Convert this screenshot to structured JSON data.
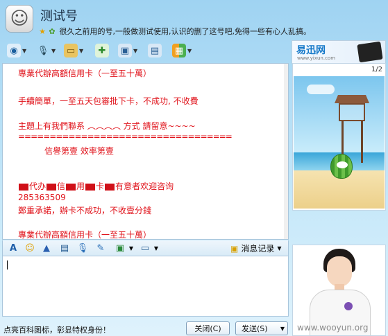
{
  "header": {
    "title": "测试号",
    "signature": "很久之前用的号,一般做测试使用,认识的删了这号吧,免得一些有心人乱搞。"
  },
  "ad": {
    "logo": "易迅网",
    "url": "www.yixun.com"
  },
  "messages": [
    "專業代辦高額信用卡（一至五十萬）",
    "手續簡單，一至五天包審批下卡，不成功, 不收費",
    "主題上有我們聯系 ︵︵︵︵  方式       請留意~~~~",
    "==================================",
    "信譽第壹          效率第壹",
    "代办",
    "信",
    "用",
    "卡",
    "有意者欢迎咨询",
    "285363509",
    "鄭重承諾，辦卡不成功，不收壹分錢",
    "專業代辦高額信用卡（一至五十萬）"
  ],
  "format_bar": {
    "history_label": "消息记录"
  },
  "footer": {
    "hint": "点亮百科图标，彰显特权身份！",
    "close_label": "关闭(C)",
    "send_label": "发送(S)"
  },
  "right_panel": {
    "pager": "1/2",
    "watermark": "www.wooyun.org"
  },
  "colors": {
    "message_text": "#e0121a",
    "window_bg": "#9fd3f2"
  }
}
